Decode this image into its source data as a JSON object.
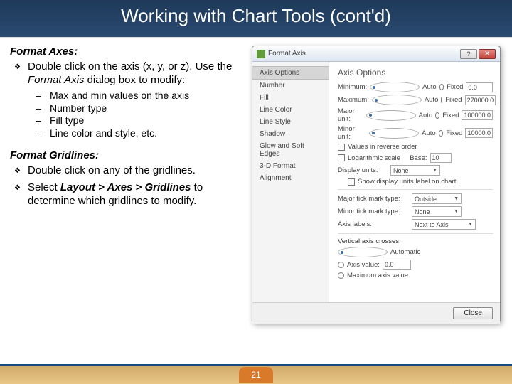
{
  "title": "Working with Chart Tools (cont'd)",
  "pageNumber": "21",
  "left": {
    "sec1_head": "Format Axes:",
    "sec1_bullet": "Double click on the axis (x, y, or z). Use the ",
    "sec1_bullet_em": "Format Axis",
    "sec1_bullet_tail": " dialog box to modify:",
    "subs": [
      "Max and min values on the axis",
      "Number type",
      "Fill type",
      "Line color and style, etc."
    ],
    "sec2_head": "Format Gridlines:",
    "sec2_b1": "Double click on any of the gridlines.",
    "sec2_b2a": "Select ",
    "sec2_b2b": "Layout > Axes > Gridlines",
    "sec2_b2c": " to determine which gridlines to modify."
  },
  "dialog": {
    "title": "Format Axis",
    "sideItems": [
      "Axis Options",
      "Number",
      "Fill",
      "Line Color",
      "Line Style",
      "Shadow",
      "Glow and Soft Edges",
      "3-D Format",
      "Alignment"
    ],
    "mainHead": "Axis Options",
    "rows": [
      {
        "label": "Minimum:",
        "auto": "Auto",
        "fixed": "Fixed",
        "val": "0.0",
        "sel": "auto"
      },
      {
        "label": "Maximum:",
        "auto": "Auto",
        "fixed": "Fixed",
        "val": "270000.0",
        "sel": "auto"
      },
      {
        "label": "Major unit:",
        "auto": "Auto",
        "fixed": "Fixed",
        "val": "100000.0",
        "sel": "auto"
      },
      {
        "label": "Minor unit:",
        "auto": "Auto",
        "fixed": "Fixed",
        "val": "10000.0",
        "sel": "auto"
      }
    ],
    "chk1": "Values in reverse order",
    "chk2lbl": "Logarithmic scale",
    "chk2base": "Base:",
    "chk2val": "10",
    "disp_lbl": "Display units:",
    "disp_val": "None",
    "chk3": "Show display units label on chart",
    "maj_lbl": "Major tick mark type:",
    "maj_val": "Outside",
    "min_lbl": "Minor tick mark type:",
    "min_val": "None",
    "axl_lbl": "Axis labels:",
    "axl_val": "Next to Axis",
    "cross_head": "Vertical axis crosses:",
    "cross_r1": "Automatic",
    "cross_r2": "Axis value:",
    "cross_r2v": "0.0",
    "cross_r3": "Maximum axis value",
    "close": "Close"
  }
}
